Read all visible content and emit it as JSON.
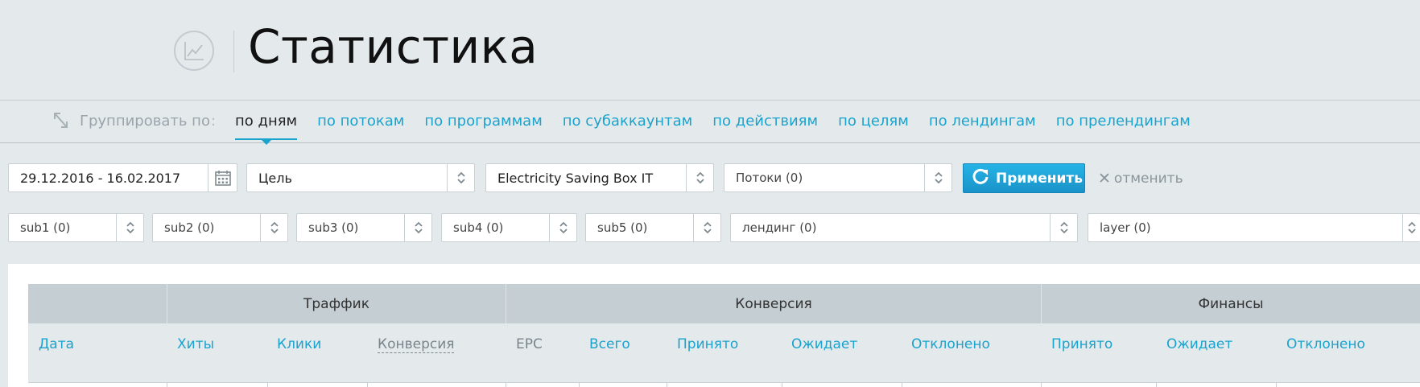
{
  "header": {
    "title": "Статистика",
    "icon": "chart-line-icon"
  },
  "group_bar": {
    "label": "Группировать по",
    "separator": ":",
    "tabs": [
      {
        "label": "по дням",
        "active": true
      },
      {
        "label": "по потокам",
        "active": false
      },
      {
        "label": "по программам",
        "active": false
      },
      {
        "label": "по субаккаунтам",
        "active": false
      },
      {
        "label": "по действиям",
        "active": false
      },
      {
        "label": "по целям",
        "active": false
      },
      {
        "label": "по лендингам",
        "active": false
      },
      {
        "label": "по прелендингам",
        "active": false
      }
    ]
  },
  "filters": {
    "date_range": "29.12.2016 - 16.02.2017",
    "goal": "Цель",
    "offer": "Electricity Saving Box IT",
    "streams": "Потоки (0)",
    "apply_label": "Применить",
    "cancel_label": "отменить",
    "sub1": "sub1 (0)",
    "sub2": "sub2 (0)",
    "sub3": "sub3 (0)",
    "sub4": "sub4 (0)",
    "sub5": "sub5 (0)",
    "landing": "лендинг (0)",
    "layer": "layer (0)"
  },
  "table": {
    "groups": {
      "traffic": "Траффик",
      "conversion": "Конверсия",
      "finance": "Финансы"
    },
    "columns": {
      "date": "Дата",
      "hits": "Хиты",
      "clicks": "Клики",
      "conversion": "Конверсия",
      "epc": "EPC",
      "total": "Всего",
      "accepted": "Принято",
      "pending": "Ожидает",
      "rejected": "Отклонено",
      "fin_accepted": "Принято",
      "fin_pending": "Ожидает",
      "fin_rejected": "Отклонено"
    }
  },
  "colors": {
    "accent": "#1aa3cc",
    "background": "#e4e9ec",
    "header_row": "#c5ced3",
    "apply_button": "#1e9fd6"
  }
}
